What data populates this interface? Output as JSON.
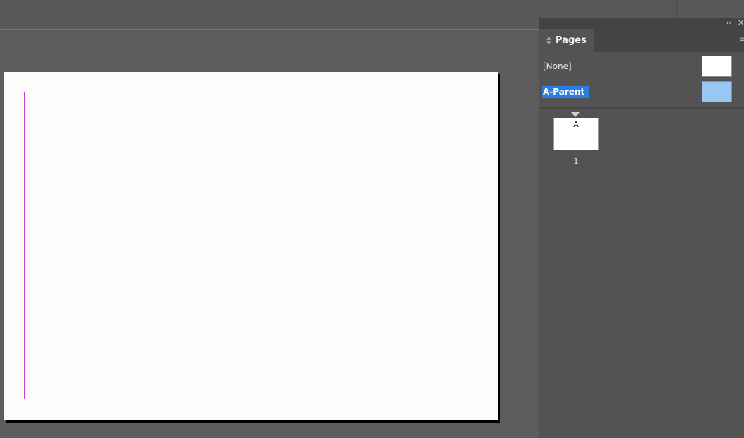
{
  "panel": {
    "collapse_glyph": "‹‹",
    "close_glyph": "✕",
    "menu_glyph": "≡",
    "tab": {
      "label": "Pages",
      "icon": "updown-arrows-icon"
    },
    "parents": [
      {
        "label": "[None]",
        "selected": false
      },
      {
        "label": "A-Parent",
        "selected": true
      }
    ],
    "pages": [
      {
        "prefix": "A",
        "number": "1"
      }
    ]
  },
  "colors": {
    "selection": "#2a7de1",
    "selected_thumb": "#99c6f3",
    "margin_guide": "#c040d8",
    "canvas": "#5b5b5b",
    "panel": "#535353"
  }
}
